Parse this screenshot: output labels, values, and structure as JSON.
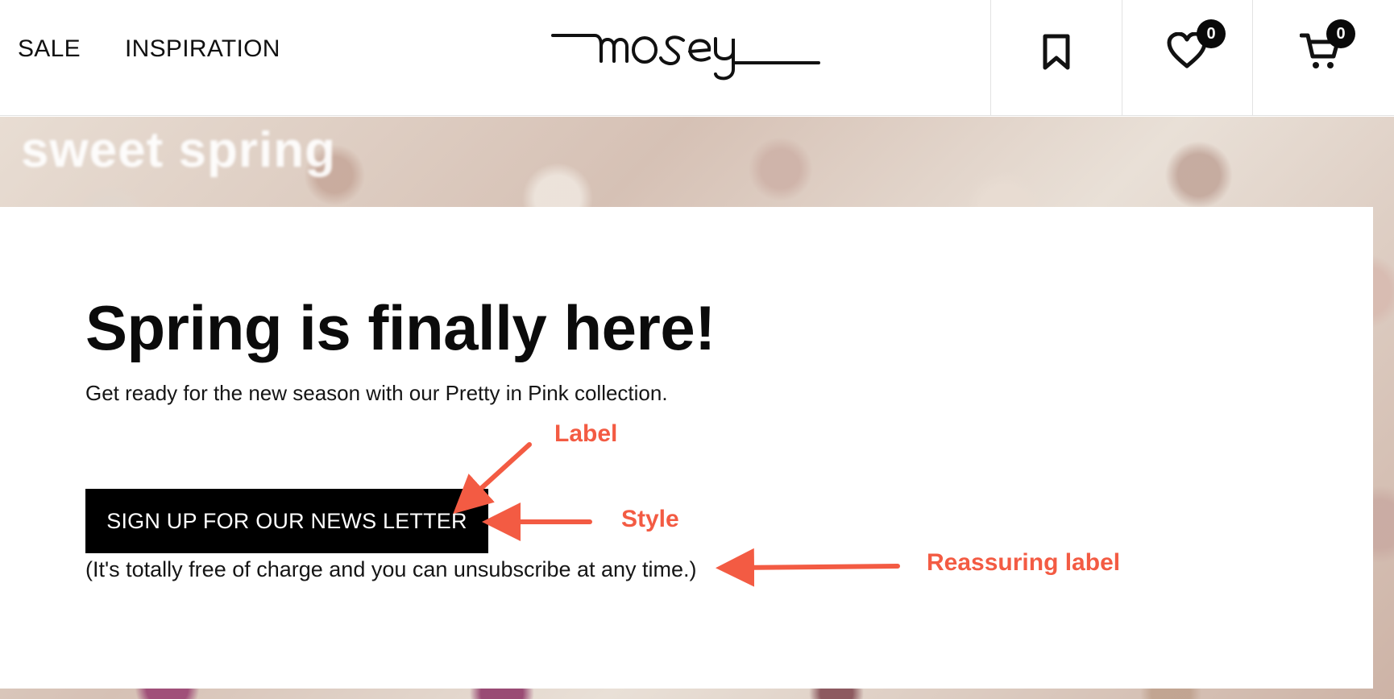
{
  "nav": {
    "sale": "SALE",
    "inspiration": "INSPIRATION"
  },
  "logo": {
    "text": "mosey"
  },
  "header_icons": [
    {
      "name": "bookmark-icon"
    },
    {
      "name": "heart-icon",
      "badge": "0"
    },
    {
      "name": "cart-icon",
      "badge": "0"
    }
  ],
  "hero": {
    "background_text": "sweet spring"
  },
  "card": {
    "title": "Spring is finally here!",
    "subtitle": "Get ready for the new season with our Pretty in Pink collection.",
    "cta_label": "SIGN UP FOR OUR NEWS LETTER",
    "reassurance": "(It's totally free of charge and you can unsubscribe at any time.)"
  },
  "annotations": {
    "label": "Label",
    "style": "Style",
    "reassuring_label": "Reassuring label",
    "color": "#f35b43"
  }
}
